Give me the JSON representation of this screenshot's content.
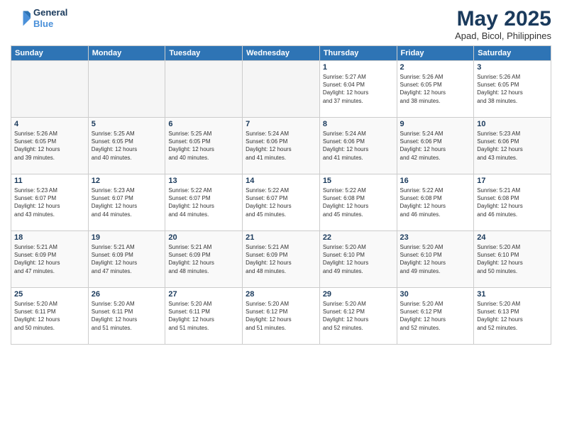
{
  "header": {
    "logo_line1": "General",
    "logo_line2": "Blue",
    "main_title": "May 2025",
    "subtitle": "Apad, Bicol, Philippines"
  },
  "weekdays": [
    "Sunday",
    "Monday",
    "Tuesday",
    "Wednesday",
    "Thursday",
    "Friday",
    "Saturday"
  ],
  "weeks": [
    [
      {
        "day": "",
        "info": ""
      },
      {
        "day": "",
        "info": ""
      },
      {
        "day": "",
        "info": ""
      },
      {
        "day": "",
        "info": ""
      },
      {
        "day": "1",
        "info": "Sunrise: 5:27 AM\nSunset: 6:04 PM\nDaylight: 12 hours\nand 37 minutes."
      },
      {
        "day": "2",
        "info": "Sunrise: 5:26 AM\nSunset: 6:05 PM\nDaylight: 12 hours\nand 38 minutes."
      },
      {
        "day": "3",
        "info": "Sunrise: 5:26 AM\nSunset: 6:05 PM\nDaylight: 12 hours\nand 38 minutes."
      }
    ],
    [
      {
        "day": "4",
        "info": "Sunrise: 5:26 AM\nSunset: 6:05 PM\nDaylight: 12 hours\nand 39 minutes."
      },
      {
        "day": "5",
        "info": "Sunrise: 5:25 AM\nSunset: 6:05 PM\nDaylight: 12 hours\nand 40 minutes."
      },
      {
        "day": "6",
        "info": "Sunrise: 5:25 AM\nSunset: 6:05 PM\nDaylight: 12 hours\nand 40 minutes."
      },
      {
        "day": "7",
        "info": "Sunrise: 5:24 AM\nSunset: 6:06 PM\nDaylight: 12 hours\nand 41 minutes."
      },
      {
        "day": "8",
        "info": "Sunrise: 5:24 AM\nSunset: 6:06 PM\nDaylight: 12 hours\nand 41 minutes."
      },
      {
        "day": "9",
        "info": "Sunrise: 5:24 AM\nSunset: 6:06 PM\nDaylight: 12 hours\nand 42 minutes."
      },
      {
        "day": "10",
        "info": "Sunrise: 5:23 AM\nSunset: 6:06 PM\nDaylight: 12 hours\nand 43 minutes."
      }
    ],
    [
      {
        "day": "11",
        "info": "Sunrise: 5:23 AM\nSunset: 6:07 PM\nDaylight: 12 hours\nand 43 minutes."
      },
      {
        "day": "12",
        "info": "Sunrise: 5:23 AM\nSunset: 6:07 PM\nDaylight: 12 hours\nand 44 minutes."
      },
      {
        "day": "13",
        "info": "Sunrise: 5:22 AM\nSunset: 6:07 PM\nDaylight: 12 hours\nand 44 minutes."
      },
      {
        "day": "14",
        "info": "Sunrise: 5:22 AM\nSunset: 6:07 PM\nDaylight: 12 hours\nand 45 minutes."
      },
      {
        "day": "15",
        "info": "Sunrise: 5:22 AM\nSunset: 6:08 PM\nDaylight: 12 hours\nand 45 minutes."
      },
      {
        "day": "16",
        "info": "Sunrise: 5:22 AM\nSunset: 6:08 PM\nDaylight: 12 hours\nand 46 minutes."
      },
      {
        "day": "17",
        "info": "Sunrise: 5:21 AM\nSunset: 6:08 PM\nDaylight: 12 hours\nand 46 minutes."
      }
    ],
    [
      {
        "day": "18",
        "info": "Sunrise: 5:21 AM\nSunset: 6:09 PM\nDaylight: 12 hours\nand 47 minutes."
      },
      {
        "day": "19",
        "info": "Sunrise: 5:21 AM\nSunset: 6:09 PM\nDaylight: 12 hours\nand 47 minutes."
      },
      {
        "day": "20",
        "info": "Sunrise: 5:21 AM\nSunset: 6:09 PM\nDaylight: 12 hours\nand 48 minutes."
      },
      {
        "day": "21",
        "info": "Sunrise: 5:21 AM\nSunset: 6:09 PM\nDaylight: 12 hours\nand 48 minutes."
      },
      {
        "day": "22",
        "info": "Sunrise: 5:20 AM\nSunset: 6:10 PM\nDaylight: 12 hours\nand 49 minutes."
      },
      {
        "day": "23",
        "info": "Sunrise: 5:20 AM\nSunset: 6:10 PM\nDaylight: 12 hours\nand 49 minutes."
      },
      {
        "day": "24",
        "info": "Sunrise: 5:20 AM\nSunset: 6:10 PM\nDaylight: 12 hours\nand 50 minutes."
      }
    ],
    [
      {
        "day": "25",
        "info": "Sunrise: 5:20 AM\nSunset: 6:11 PM\nDaylight: 12 hours\nand 50 minutes."
      },
      {
        "day": "26",
        "info": "Sunrise: 5:20 AM\nSunset: 6:11 PM\nDaylight: 12 hours\nand 51 minutes."
      },
      {
        "day": "27",
        "info": "Sunrise: 5:20 AM\nSunset: 6:11 PM\nDaylight: 12 hours\nand 51 minutes."
      },
      {
        "day": "28",
        "info": "Sunrise: 5:20 AM\nSunset: 6:12 PM\nDaylight: 12 hours\nand 51 minutes."
      },
      {
        "day": "29",
        "info": "Sunrise: 5:20 AM\nSunset: 6:12 PM\nDaylight: 12 hours\nand 52 minutes."
      },
      {
        "day": "30",
        "info": "Sunrise: 5:20 AM\nSunset: 6:12 PM\nDaylight: 12 hours\nand 52 minutes."
      },
      {
        "day": "31",
        "info": "Sunrise: 5:20 AM\nSunset: 6:13 PM\nDaylight: 12 hours\nand 52 minutes."
      }
    ]
  ]
}
